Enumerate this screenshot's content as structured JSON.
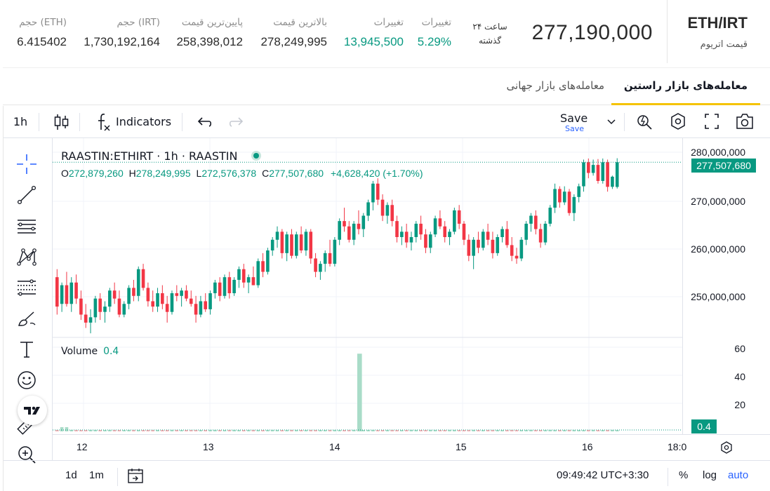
{
  "header": {
    "pair": "ETH/IRT",
    "pair_subtitle": "قیمت اتریوم",
    "last_price": "277,190,000",
    "period_line1": "۲۴ ساعت",
    "period_line2": "گذشته",
    "stats": [
      {
        "label": "تغییرات",
        "value": "5.29%",
        "color": "green"
      },
      {
        "label": "تغییرات",
        "value": "13,945,500",
        "color": "green"
      },
      {
        "label": "بالاترین قیمت",
        "value": "278,249,995",
        "color": ""
      },
      {
        "label": "پایین‌ترین قیمت",
        "value": "258,398,012",
        "color": ""
      },
      {
        "label": "حجم (IRT)",
        "value": "1,730,192,164",
        "color": ""
      },
      {
        "label": "حجم (ETH)",
        "value": "6.415402",
        "color": ""
      }
    ]
  },
  "tabs": [
    {
      "label": "معامله‌های بازار راستین",
      "active": true
    },
    {
      "label": "معامله‌های بازار جهانی",
      "active": false
    }
  ],
  "toolbar": {
    "interval": "1h",
    "indicators_label": "Indicators",
    "save_label": "Save",
    "save_sub": "Save"
  },
  "legend": {
    "symbol_line": "RAASTIN:ETHIRT · 1h · RAASTIN",
    "o_label": "O",
    "o_value": "272,879,260",
    "h_label": "H",
    "h_value": "278,249,995",
    "l_label": "L",
    "l_value": "272,576,378",
    "c_label": "C",
    "c_value": "277,507,680",
    "change": "+4,628,420 (+1.70%)",
    "volume_label": "Volume",
    "volume_value": "0.4"
  },
  "price_axis": {
    "labels": [
      "280,000,000",
      "270,000,000",
      "260,000,000",
      "250,000,000"
    ],
    "current_tag": "277,507,680"
  },
  "volume_axis": {
    "labels": [
      "60",
      "40",
      "20"
    ],
    "current_tag": "0.4"
  },
  "time_axis": {
    "labels": [
      "12",
      "13",
      "14",
      "15",
      "16",
      "18:0"
    ]
  },
  "bottombar": {
    "range_1d": "1d",
    "range_1m": "1m",
    "clock": "09:49:42 UTC+3:30",
    "percent": "%",
    "log": "log",
    "auto": "auto"
  },
  "colors": {
    "up": "#089981",
    "down": "#f23645",
    "accent": "#f5c300",
    "link": "#2962ff"
  },
  "chart_data": {
    "type": "candlestick",
    "symbol": "RAASTIN:ETHIRT",
    "interval": "1h",
    "ylim": [
      245000000,
      282000000
    ],
    "volume_ylim": [
      0,
      65
    ],
    "ohlc": [
      [
        256000000,
        257500000,
        249000000,
        250500000
      ],
      [
        251000000,
        255000000,
        249500000,
        254500000
      ],
      [
        254500000,
        257000000,
        250500000,
        251000000
      ],
      [
        251000000,
        256000000,
        249500000,
        255000000
      ],
      [
        255000000,
        256500000,
        251000000,
        252000000
      ],
      [
        252000000,
        253500000,
        248000000,
        249000000
      ],
      [
        249000000,
        251000000,
        246500000,
        247500000
      ],
      [
        247500000,
        250000000,
        245500000,
        248500000
      ],
      [
        248500000,
        252500000,
        247500000,
        252000000
      ],
      [
        252000000,
        253000000,
        248000000,
        249500000
      ],
      [
        249500000,
        251500000,
        247500000,
        250500000
      ],
      [
        250500000,
        254000000,
        249500000,
        253500000
      ],
      [
        253500000,
        255000000,
        251000000,
        252000000
      ],
      [
        252000000,
        253500000,
        248500000,
        249000000
      ],
      [
        249000000,
        251500000,
        248500000,
        251000000
      ],
      [
        251000000,
        254500000,
        250000000,
        254000000
      ],
      [
        254000000,
        255500000,
        251500000,
        252500000
      ],
      [
        252500000,
        258000000,
        251500000,
        257500000
      ],
      [
        257500000,
        258500000,
        253500000,
        254000000
      ],
      [
        254000000,
        255000000,
        250500000,
        251500000
      ],
      [
        251500000,
        253500000,
        249500000,
        250500000
      ],
      [
        250500000,
        254000000,
        249500000,
        253000000
      ],
      [
        253000000,
        254500000,
        250000000,
        251000000
      ],
      [
        251000000,
        252500000,
        247500000,
        249500000
      ],
      [
        249500000,
        253500000,
        249000000,
        253000000
      ],
      [
        253000000,
        254500000,
        251500000,
        252500000
      ],
      [
        252500000,
        254000000,
        250500000,
        253500000
      ],
      [
        253500000,
        254500000,
        251500000,
        252000000
      ],
      [
        252000000,
        253500000,
        250500000,
        251000000
      ],
      [
        251000000,
        252500000,
        247500000,
        249000000
      ],
      [
        249000000,
        252500000,
        248500000,
        251500000
      ],
      [
        251500000,
        253000000,
        249500000,
        250000000
      ],
      [
        250000000,
        253500000,
        249000000,
        253000000
      ],
      [
        253000000,
        255500000,
        252000000,
        255000000
      ],
      [
        255000000,
        256000000,
        251500000,
        252500000
      ],
      [
        252500000,
        256500000,
        252000000,
        256000000
      ],
      [
        256000000,
        257000000,
        252000000,
        253000000
      ],
      [
        253000000,
        256000000,
        252500000,
        255500000
      ],
      [
        255500000,
        258000000,
        254000000,
        257500000
      ],
      [
        257500000,
        258500000,
        254000000,
        255000000
      ],
      [
        255000000,
        256500000,
        253000000,
        256000000
      ],
      [
        256000000,
        258000000,
        254500000,
        254500000
      ],
      [
        254500000,
        259500000,
        254000000,
        259000000
      ],
      [
        259000000,
        260500000,
        256000000,
        257000000
      ],
      [
        257000000,
        261500000,
        256500000,
        261000000
      ],
      [
        261000000,
        263500000,
        260000000,
        263000000
      ],
      [
        263000000,
        265500000,
        261500000,
        264500000
      ],
      [
        264500000,
        265000000,
        259500000,
        260500000
      ],
      [
        260500000,
        264500000,
        259000000,
        264000000
      ],
      [
        264000000,
        265000000,
        259500000,
        260000000
      ],
      [
        260000000,
        264500000,
        259500000,
        264000000
      ],
      [
        264000000,
        265500000,
        260500000,
        261000000
      ],
      [
        261000000,
        265000000,
        260000000,
        264500000
      ],
      [
        264500000,
        265000000,
        258500000,
        259500000
      ],
      [
        259500000,
        260500000,
        256000000,
        257000000
      ],
      [
        257000000,
        259000000,
        255500000,
        258500000
      ],
      [
        258500000,
        261000000,
        257000000,
        260500000
      ],
      [
        260500000,
        263000000,
        258000000,
        258500000
      ],
      [
        258500000,
        263500000,
        258000000,
        263000000
      ],
      [
        263000000,
        267000000,
        262000000,
        266500000
      ],
      [
        266500000,
        269000000,
        264500000,
        265500000
      ],
      [
        265500000,
        266500000,
        262500000,
        263000000
      ],
      [
        263000000,
        266500000,
        262000000,
        266000000
      ],
      [
        266000000,
        268500000,
        264000000,
        265000000
      ],
      [
        265000000,
        268000000,
        263500000,
        267500000
      ],
      [
        267500000,
        270500000,
        266500000,
        270000000
      ],
      [
        270000000,
        274000000,
        268500000,
        273500000
      ],
      [
        273500000,
        274500000,
        269500000,
        270500000
      ],
      [
        270500000,
        271500000,
        266500000,
        267500000
      ],
      [
        267500000,
        270000000,
        266000000,
        269500000
      ],
      [
        269500000,
        270500000,
        265500000,
        266500000
      ],
      [
        266500000,
        267500000,
        262500000,
        263500000
      ],
      [
        263500000,
        265500000,
        262000000,
        264500000
      ],
      [
        264500000,
        266000000,
        261500000,
        262500000
      ],
      [
        262500000,
        264500000,
        261000000,
        263500000
      ],
      [
        263500000,
        266500000,
        262500000,
        266000000
      ],
      [
        266000000,
        267500000,
        263000000,
        264000000
      ],
      [
        264000000,
        265000000,
        260500000,
        261500000
      ],
      [
        261500000,
        264500000,
        260500000,
        264000000
      ],
      [
        264000000,
        267500000,
        263500000,
        267000000
      ],
      [
        267000000,
        268500000,
        265000000,
        265500000
      ],
      [
        265500000,
        266500000,
        262500000,
        263500000
      ],
      [
        263500000,
        265000000,
        262000000,
        264500000
      ],
      [
        264500000,
        269000000,
        264000000,
        268500000
      ],
      [
        268500000,
        269500000,
        265000000,
        266000000
      ],
      [
        266000000,
        266500000,
        262000000,
        263000000
      ],
      [
        263000000,
        264000000,
        259000000,
        260000000
      ],
      [
        260000000,
        263500000,
        257500000,
        263000000
      ],
      [
        263000000,
        264500000,
        260500000,
        261500000
      ],
      [
        261500000,
        265000000,
        261000000,
        264500000
      ],
      [
        264500000,
        266000000,
        262000000,
        263000000
      ],
      [
        263000000,
        264500000,
        259500000,
        260500000
      ],
      [
        260500000,
        264000000,
        260000000,
        263500000
      ],
      [
        263500000,
        265500000,
        262500000,
        265000000
      ],
      [
        265000000,
        266500000,
        261500000,
        262000000
      ],
      [
        262000000,
        263500000,
        259000000,
        260000000
      ],
      [
        260000000,
        261500000,
        258500000,
        259500000
      ],
      [
        259500000,
        263500000,
        259000000,
        263000000
      ],
      [
        263000000,
        266500000,
        262000000,
        266000000
      ],
      [
        266000000,
        268000000,
        264500000,
        267500000
      ],
      [
        267500000,
        268500000,
        264000000,
        265000000
      ],
      [
        265000000,
        266000000,
        261500000,
        262500000
      ],
      [
        262500000,
        266500000,
        262000000,
        266000000
      ],
      [
        266000000,
        269500000,
        265500000,
        269000000
      ],
      [
        269000000,
        273500000,
        268000000,
        272500000
      ],
      [
        272500000,
        273000000,
        269000000,
        270000000
      ],
      [
        270000000,
        273000000,
        269500000,
        272000000
      ],
      [
        272000000,
        272500000,
        267500000,
        268000000
      ],
      [
        268000000,
        271500000,
        266500000,
        271000000
      ],
      [
        271000000,
        273500000,
        270000000,
        273000000
      ],
      [
        273000000,
        278000000,
        272000000,
        277500000
      ],
      [
        277500000,
        278200000,
        274500000,
        275500000
      ],
      [
        275500000,
        278000000,
        275000000,
        277000000
      ],
      [
        277000000,
        278100000,
        273500000,
        274000000
      ],
      [
        274000000,
        278200000,
        273500000,
        277500000
      ],
      [
        277500000,
        278000000,
        272000000,
        272900000
      ],
      [
        272900000,
        275000000,
        272500000,
        274800000
      ],
      [
        272879260,
        278249995,
        272576378,
        277507680
      ]
    ],
    "volume_spike": {
      "value": 60
    }
  }
}
